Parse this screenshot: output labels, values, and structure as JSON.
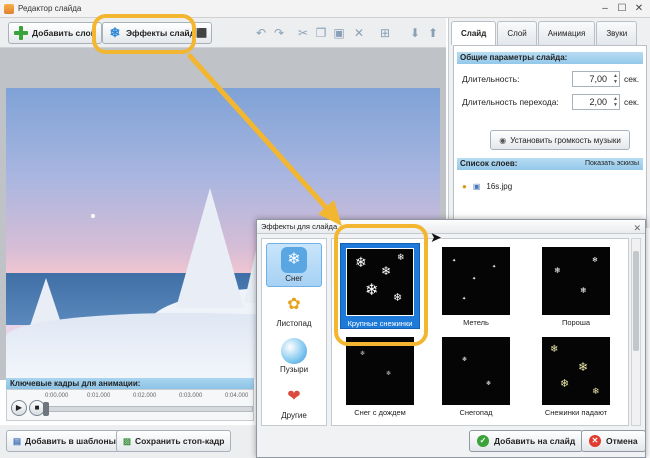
{
  "window": {
    "title": "Редактор слайда"
  },
  "toolbar": {
    "add_layer": "Добавить слой",
    "effects": "Эффекты слайда"
  },
  "right_panel": {
    "tabs": [
      "Слайд",
      "Слой",
      "Анимация",
      "Звуки"
    ],
    "general_header": "Общие параметры слайда:",
    "duration_label": "Длительность:",
    "duration_value": "7,00",
    "transition_label": "Длительность перехода:",
    "transition_value": "2,00",
    "unit": "сек.",
    "volume_button": "Установить громкость музыки",
    "layers_header": "Список слоев:",
    "show_thumbs": "Показать эскизы",
    "layer_file": "16s.jpg"
  },
  "keyframes": {
    "header": "Ключевые кадры для анимации:",
    "ticks": [
      "0:00.000",
      "0:01.000",
      "0:02.000",
      "0:03.000",
      "0:04.000"
    ]
  },
  "bottom": {
    "add_template": "Добавить в шаблоны",
    "save_frame": "Сохранить стоп-кадр"
  },
  "dialog": {
    "title": "Эффекты для слайда",
    "categories": [
      {
        "label": "Снег",
        "icon": "snowflake-icon"
      },
      {
        "label": "Листопад",
        "icon": "leaf-icon"
      },
      {
        "label": "Пузыри",
        "icon": "bubble-icon"
      },
      {
        "label": "Другие",
        "icon": "hearts-icon"
      }
    ],
    "effects": [
      "Крупные снежинки",
      "Метель",
      "Пороша",
      "Снег с дождем",
      "Снегопад",
      "Снежинки падают"
    ],
    "add_button": "Добавить на слайд",
    "cancel_button": "Отмена"
  },
  "colors": {
    "highlight": "#f2b631",
    "accent": "#1e7ad8"
  }
}
